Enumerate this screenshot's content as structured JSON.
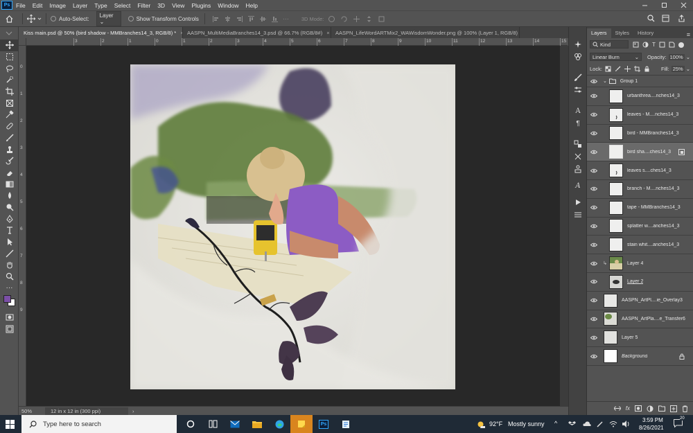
{
  "menu": {
    "logo": "Ps",
    "items": [
      "File",
      "Edit",
      "Image",
      "Layer",
      "Type",
      "Select",
      "Filter",
      "3D",
      "View",
      "Plugins",
      "Window",
      "Help"
    ]
  },
  "options": {
    "auto_select_label": "Auto-Select:",
    "auto_select_value": "Layer",
    "transform_label": "Show Transform Controls",
    "mode_3d_label": "3D Mode:"
  },
  "tabs": [
    {
      "label": "Kiss main.psd @ 50% (bird shadow - MMBranches14_3, RGB/8) *",
      "close": "×"
    },
    {
      "label": "AASPN_MultiMediaBranches14_3.psd @ 66.7% (RGB/8#)",
      "close": "×"
    },
    {
      "label": "AASPN_LifeWordARTMix2_WAWisdomWonder.png @ 100% (Layer 1, RGB/8)",
      "close": "×"
    }
  ],
  "rulers": {
    "top": [
      "3",
      "2",
      "1",
      "0",
      "1",
      "2",
      "3",
      "4",
      "5",
      "6",
      "7",
      "8",
      "9",
      "10",
      "11",
      "12",
      "13",
      "14",
      "15"
    ],
    "left": [
      "0",
      "1",
      "2",
      "3",
      "4",
      "5",
      "6",
      "7",
      "8",
      "9"
    ]
  },
  "status": {
    "zoom": "50%",
    "doc_info": "12 in x 12 in (300 ppi)",
    "arrow": "›"
  },
  "panel": {
    "tabs": [
      "Layers",
      "Styles",
      "History"
    ],
    "filter_label": "Kind",
    "blend_mode": "Linear Burn",
    "opacity_label": "Opacity:",
    "opacity_value": "100%",
    "lock_label": "Lock:",
    "fill_label": "Fill:",
    "fill_value": "25%",
    "layers": [
      {
        "name": "Group 1",
        "type": "group"
      },
      {
        "name": "urbanthrea....nches14_3"
      },
      {
        "name": "leaves - M....nches14_3"
      },
      {
        "name": "bird - MMBranches14_3"
      },
      {
        "name": "bird sha....ches14_3",
        "selected": true
      },
      {
        "name": "leaves s....ches14_3"
      },
      {
        "name": "branch - M....nches14_3"
      },
      {
        "name": "tape - MMBranches14_3"
      },
      {
        "name": "splatter w....anches14_3"
      },
      {
        "name": "stain whit....anches14_3"
      },
      {
        "name": "Layer 4"
      },
      {
        "name": "Layer 2"
      },
      {
        "name": "AASPN_ArtPl....ie_Overlay3"
      },
      {
        "name": "AASPN_ArtPla....e_Transfer6"
      },
      {
        "name": "Layer 5"
      },
      {
        "name": "Background",
        "locked": true
      }
    ],
    "bottom_fx": "fx"
  },
  "taskbar": {
    "search_placeholder": "Type here to search",
    "weather_temp": "92°F",
    "weather_desc": "Mostly sunny",
    "time": "3:59 PM",
    "date": "8/26/2021",
    "ps_label": "Ps",
    "notif_count": "20"
  },
  "colors": {
    "foreground": "#7b4fa6",
    "background": "#ffffff",
    "accent": "#31a8ff"
  }
}
